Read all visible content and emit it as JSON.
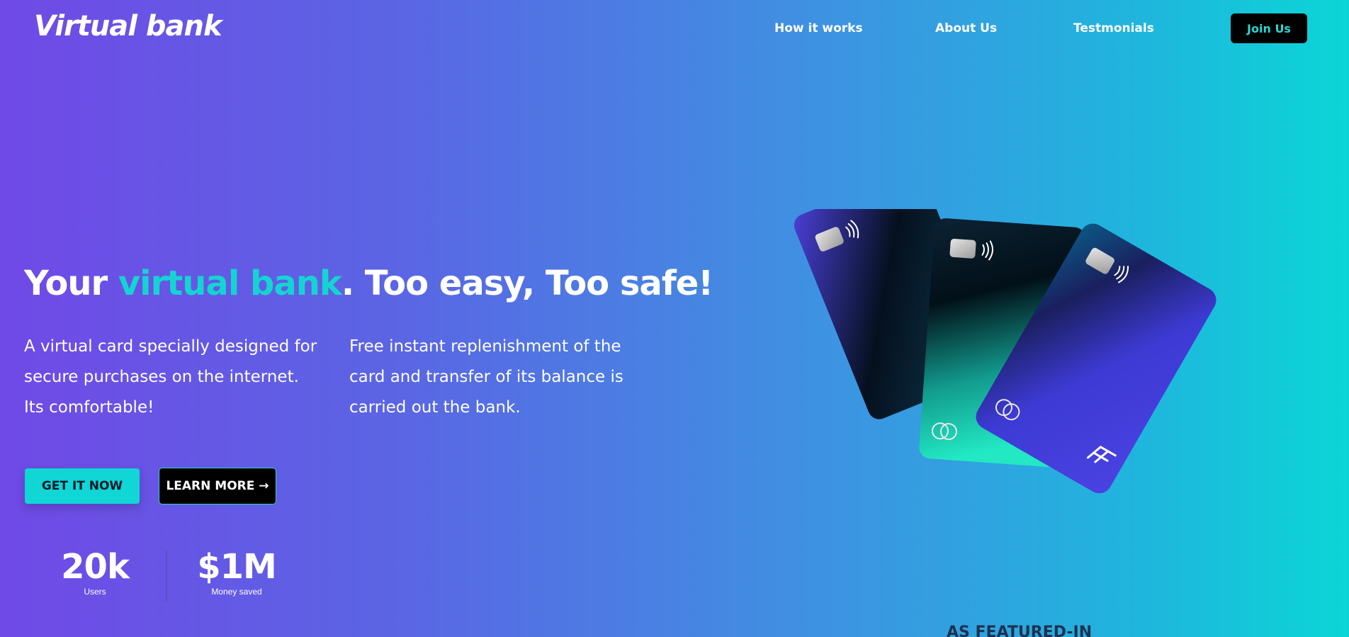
{
  "brand": {
    "logo_text": "Virtual bank"
  },
  "nav": {
    "links": [
      "How it works",
      "About Us",
      "Testmonials"
    ],
    "join_label": "Join Us"
  },
  "hero": {
    "headline_prefix": "Your ",
    "headline_accent": "virtual bank",
    "headline_suffix": ". Too easy, Too safe!",
    "desc_left": "A virtual card specially designed for secure purchases on the internet. Its comfortable!",
    "desc_right": "Free instant replenishment of the card and transfer of its balance is carried out the bank.",
    "cta_primary": "GET IT NOW",
    "cta_secondary": "LEARN MORE →"
  },
  "stats": [
    {
      "value": "20k",
      "label": "Users"
    },
    {
      "value": "$1M",
      "label": "Money saved"
    }
  ],
  "featured": {
    "title": "AS FEATURED-IN"
  },
  "colors": {
    "accent": "#14d4d2",
    "background_start": "#7049e6",
    "background_end": "#0bd6d6",
    "button_dark": "#000000"
  },
  "icons": {
    "chip": "card-chip-icon",
    "contactless": "contactless-icon",
    "card_network": "card-network-icon",
    "card_brand": "card-brand-logo-icon"
  }
}
